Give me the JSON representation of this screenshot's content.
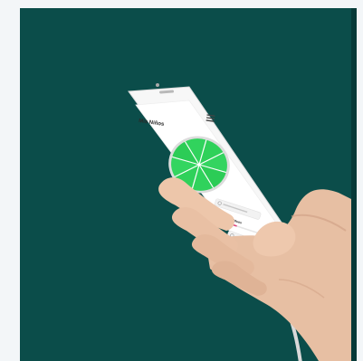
{
  "photo": {
    "background_color": "#0b4d4a",
    "phone_color": "#f7f7f7",
    "chart_color": "#2fd15a",
    "accent_color": "#e0457b"
  },
  "app_screen": {
    "title": "Mis Niños",
    "menu_icon": "menu-icon",
    "row_label": "Mis Residuos",
    "row_percent": "66%",
    "progress_fraction": 0.33
  }
}
